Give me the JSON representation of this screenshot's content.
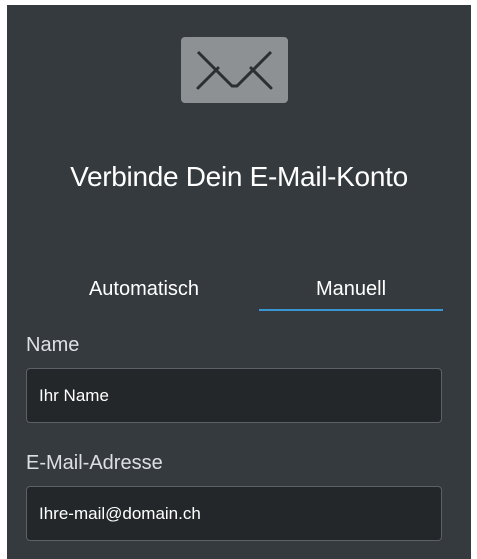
{
  "header": {
    "icon": "envelope-icon",
    "title": "Verbinde Dein E-Mail-Konto"
  },
  "tabs": [
    {
      "label": "Automatisch",
      "active": false
    },
    {
      "label": "Manuell",
      "active": true
    }
  ],
  "form": {
    "name": {
      "label": "Name",
      "placeholder": "Ihr Name",
      "value": ""
    },
    "email": {
      "label": "E-Mail-Adresse",
      "placeholder": "Ihre-mail@domain.ch",
      "value": ""
    }
  },
  "colors": {
    "panel_background": "#353a3e",
    "input_background": "#23272a",
    "active_tab_underline": "#3a96d2",
    "icon_background": "#8e9193"
  }
}
